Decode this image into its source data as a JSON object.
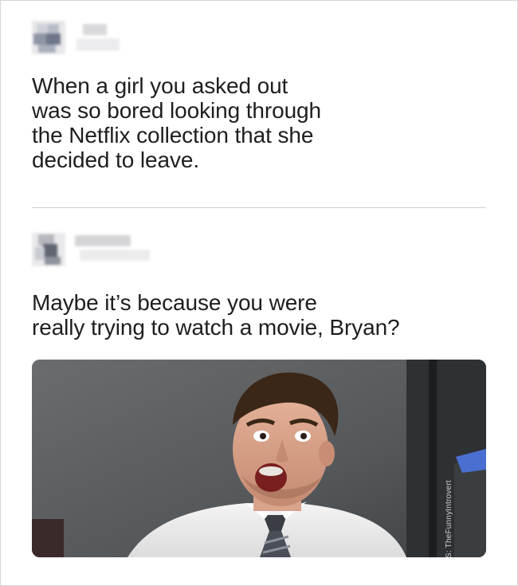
{
  "tweets": [
    {
      "author": "",
      "text": "When a girl you asked out\nwas so bored looking through\nthe Netflix collection that she\ndecided to leave."
    },
    {
      "author": "",
      "text": "Maybe it’s because you were\nreally trying to watch a movie, Bryan?",
      "media": {
        "type": "reaction-gif",
        "watermark": "S: TheFunnyIntrovert"
      }
    }
  ]
}
